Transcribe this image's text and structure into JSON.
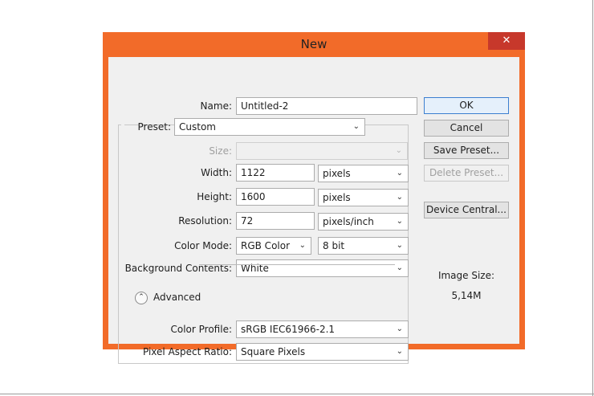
{
  "dialog": {
    "title": "New",
    "close_glyph": "✕",
    "name": {
      "label": "Name:",
      "value": "Untitled-2"
    },
    "preset": {
      "label": "Preset:",
      "value": "Custom"
    },
    "size": {
      "label": "Size:",
      "value": ""
    },
    "width": {
      "label": "Width:",
      "value": "1122",
      "unit": "pixels"
    },
    "height": {
      "label": "Height:",
      "value": "1600",
      "unit": "pixels"
    },
    "resolution": {
      "label": "Resolution:",
      "value": "72",
      "unit": "pixels/inch"
    },
    "color_mode": {
      "label": "Color Mode:",
      "value": "RGB Color",
      "bit_depth": "8 bit"
    },
    "background": {
      "label": "Background Contents:",
      "value": "White"
    },
    "advanced": {
      "label": "Advanced",
      "icon": "collapse-icon"
    },
    "color_profile": {
      "label": "Color Profile:",
      "value": "sRGB IEC61966-2.1"
    },
    "pixel_aspect": {
      "label": "Pixel Aspect Ratio:",
      "value": "Square Pixels"
    },
    "buttons": {
      "ok": "OK",
      "cancel": "Cancel",
      "save_preset": "Save Preset...",
      "delete_preset": "Delete Preset...",
      "device_central": "Device Central..."
    },
    "image_size": {
      "label": "Image Size:",
      "value": "5,14M"
    }
  },
  "colors": {
    "window_frame": "#f26b29",
    "close_button": "#c7382b",
    "client_background": "#f0f0f0"
  }
}
